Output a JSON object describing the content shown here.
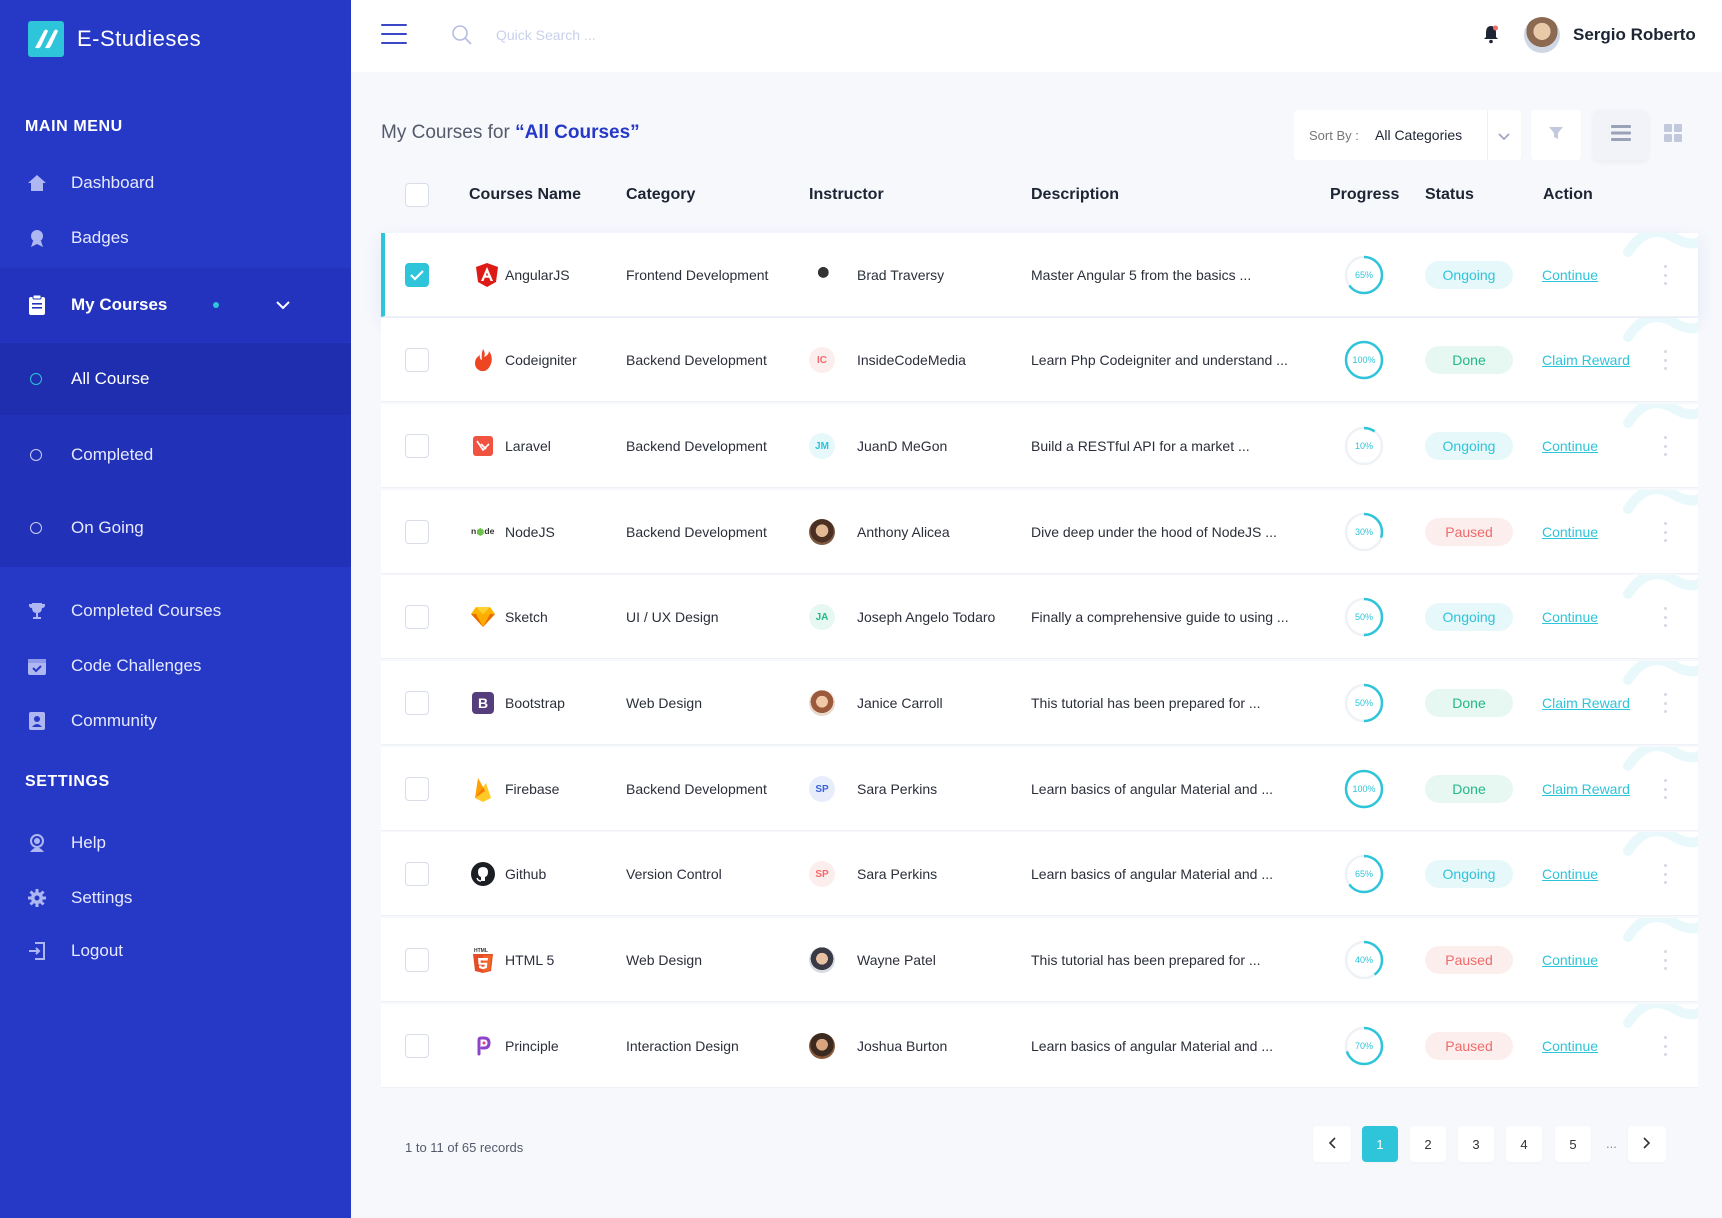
{
  "app": {
    "name": "E-Studieses"
  },
  "sidebar": {
    "main_heading": "MAIN MENU",
    "items": [
      {
        "label": "Dashboard",
        "icon": "home-icon"
      },
      {
        "label": "Badges",
        "icon": "badge-icon"
      },
      {
        "label": "My Courses",
        "icon": "clipboard-icon"
      }
    ],
    "submenu": [
      {
        "label": "All Course"
      },
      {
        "label": "Completed"
      },
      {
        "label": "On Going"
      }
    ],
    "more_items": [
      {
        "label": "Completed Courses",
        "icon": "trophy-icon"
      },
      {
        "label": "Code Challenges",
        "icon": "calendar-check-icon"
      },
      {
        "label": "Community",
        "icon": "community-icon"
      }
    ],
    "settings_heading": "SETTINGS",
    "settings_items": [
      {
        "label": "Help",
        "icon": "help-icon"
      },
      {
        "label": "Settings",
        "icon": "gear-icon"
      },
      {
        "label": "Logout",
        "icon": "logout-icon"
      }
    ]
  },
  "topbar": {
    "search_placeholder": "Quick Search ...",
    "user_name": "Sergio Roberto"
  },
  "page": {
    "title_prefix": "My Courses for ",
    "title_filter": "“All Courses”",
    "sort_label": "Sort By :",
    "sort_value": "All Categories"
  },
  "table": {
    "headers": {
      "name": "Courses Name",
      "category": "Category",
      "instructor": "Instructor",
      "description": "Description",
      "progress": "Progress",
      "status": "Status",
      "action": "Action"
    },
    "rows": [
      {
        "name": "AngularJS",
        "category": "Frontend Development",
        "instructor": "Brad Traversy",
        "initials": "",
        "description": "Master Angular 5 from the basics ...",
        "progress": 65,
        "progress_label": "65%",
        "status": "Ongoing",
        "action": "Continue",
        "checked": true
      },
      {
        "name": "Codeigniter",
        "category": "Backend Development",
        "instructor": "InsideCodeMedia",
        "initials": "IC",
        "description": "Learn Php Codeigniter and understand ...",
        "progress": 100,
        "progress_label": "100%",
        "status": "Done",
        "action": "Claim Reward",
        "checked": false
      },
      {
        "name": "Laravel",
        "category": "Backend Development",
        "instructor": "JuanD MeGon",
        "initials": "JM",
        "description": "Build a RESTful API for a market ...",
        "progress": 10,
        "progress_label": "10%",
        "status": "Ongoing",
        "action": "Continue",
        "checked": false
      },
      {
        "name": "NodeJS",
        "category": "Backend Development",
        "instructor": "Anthony Alicea",
        "initials": "",
        "description": "Dive deep under the hood of NodeJS ...",
        "progress": 30,
        "progress_label": "30%",
        "status": "Paused",
        "action": "Continue",
        "checked": false
      },
      {
        "name": "Sketch",
        "category": "UI / UX Design",
        "instructor": "Joseph Angelo Todaro",
        "initials": "JA",
        "description": "Finally a comprehensive guide to using ...",
        "progress": 50,
        "progress_label": "50%",
        "status": "Ongoing",
        "action": "Continue",
        "checked": false
      },
      {
        "name": "Bootstrap",
        "category": "Web Design",
        "instructor": "Janice Carroll",
        "initials": "",
        "description": "This tutorial has been prepared for ...",
        "progress": 50,
        "progress_label": "50%",
        "status": "Done",
        "action": "Claim Reward",
        "checked": false
      },
      {
        "name": "Firebase",
        "category": "Backend Development",
        "instructor": "Sara Perkins",
        "initials": "SP",
        "description": "Learn basics of angular Material and ...",
        "progress": 100,
        "progress_label": "100%",
        "status": "Done",
        "action": "Claim Reward",
        "checked": false
      },
      {
        "name": "Github",
        "category": "Version Control",
        "instructor": "Sara Perkins",
        "initials": "SP",
        "description": "Learn basics of angular Material and ...",
        "progress": 65,
        "progress_label": "65%",
        "status": "Ongoing",
        "action": "Continue",
        "checked": false
      },
      {
        "name": "HTML 5",
        "category": "Web Design",
        "instructor": "Wayne Patel",
        "initials": "",
        "description": "This tutorial has been prepared for ...",
        "progress": 40,
        "progress_label": "40%",
        "status": "Paused",
        "action": "Continue",
        "checked": false
      },
      {
        "name": "Principle",
        "category": "Interaction Design",
        "instructor": "Joshua Burton",
        "initials": "",
        "description": "Learn basics of angular Material and ...",
        "progress": 70,
        "progress_label": "70%",
        "status": "Paused",
        "action": "Continue",
        "checked": false
      }
    ]
  },
  "footer": {
    "records": "1 to 11 of 65 records",
    "pages": [
      "1",
      "2",
      "3",
      "4",
      "5"
    ],
    "ellipsis": "...",
    "current_page": "1"
  },
  "colors": {
    "sidebar": "#2538c6",
    "accent": "#2ec4d9",
    "done": "#24b78a",
    "paused": "#ef6a6a"
  }
}
